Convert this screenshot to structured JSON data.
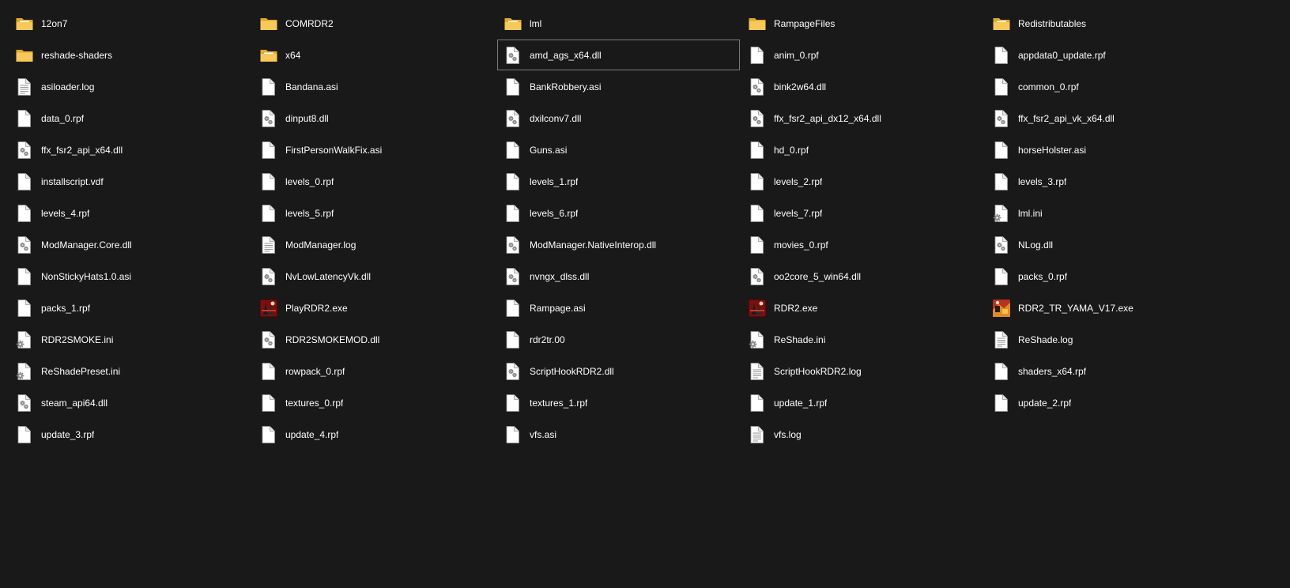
{
  "colors": {
    "background": "#191919",
    "text": "#ffffff",
    "folder": "#f0c14b",
    "selection_border": "#7a7a7a"
  },
  "items": [
    {
      "name": "12on7",
      "icon": "folder-open-icon",
      "selected": false
    },
    {
      "name": "COMRDR2",
      "icon": "folder-icon",
      "selected": false
    },
    {
      "name": "lml",
      "icon": "folder-open-icon",
      "selected": false
    },
    {
      "name": "RampageFiles",
      "icon": "folder-icon",
      "selected": false
    },
    {
      "name": "Redistributables",
      "icon": "folder-open-icon",
      "selected": false
    },
    {
      "name": "reshade-shaders",
      "icon": "folder-icon",
      "selected": false
    },
    {
      "name": "x64",
      "icon": "folder-open-icon",
      "selected": false
    },
    {
      "name": "amd_ags_x64.dll",
      "icon": "dll-file-icon",
      "selected": true
    },
    {
      "name": "anim_0.rpf",
      "icon": "file-icon",
      "selected": false
    },
    {
      "name": "appdata0_update.rpf",
      "icon": "file-icon",
      "selected": false
    },
    {
      "name": "asiloader.log",
      "icon": "text-file-icon",
      "selected": false
    },
    {
      "name": "Bandana.asi",
      "icon": "file-icon",
      "selected": false
    },
    {
      "name": "BankRobbery.asi",
      "icon": "file-icon",
      "selected": false
    },
    {
      "name": "bink2w64.dll",
      "icon": "dll-file-icon",
      "selected": false
    },
    {
      "name": "common_0.rpf",
      "icon": "file-icon",
      "selected": false
    },
    {
      "name": "data_0.rpf",
      "icon": "file-icon",
      "selected": false
    },
    {
      "name": "dinput8.dll",
      "icon": "dll-file-icon",
      "selected": false
    },
    {
      "name": "dxilconv7.dll",
      "icon": "dll-file-icon",
      "selected": false
    },
    {
      "name": "ffx_fsr2_api_dx12_x64.dll",
      "icon": "dll-file-icon",
      "selected": false
    },
    {
      "name": "ffx_fsr2_api_vk_x64.dll",
      "icon": "dll-file-icon",
      "selected": false
    },
    {
      "name": "ffx_fsr2_api_x64.dll",
      "icon": "dll-file-icon",
      "selected": false
    },
    {
      "name": "FirstPersonWalkFix.asi",
      "icon": "file-icon",
      "selected": false
    },
    {
      "name": "Guns.asi",
      "icon": "file-icon",
      "selected": false
    },
    {
      "name": "hd_0.rpf",
      "icon": "file-icon",
      "selected": false
    },
    {
      "name": "horseHolster.asi",
      "icon": "file-icon",
      "selected": false
    },
    {
      "name": "installscript.vdf",
      "icon": "file-icon",
      "selected": false
    },
    {
      "name": "levels_0.rpf",
      "icon": "file-icon",
      "selected": false
    },
    {
      "name": "levels_1.rpf",
      "icon": "file-icon",
      "selected": false
    },
    {
      "name": "levels_2.rpf",
      "icon": "file-icon",
      "selected": false
    },
    {
      "name": "levels_3.rpf",
      "icon": "file-icon",
      "selected": false
    },
    {
      "name": "levels_4.rpf",
      "icon": "file-icon",
      "selected": false
    },
    {
      "name": "levels_5.rpf",
      "icon": "file-icon",
      "selected": false
    },
    {
      "name": "levels_6.rpf",
      "icon": "file-icon",
      "selected": false
    },
    {
      "name": "levels_7.rpf",
      "icon": "file-icon",
      "selected": false
    },
    {
      "name": "lml.ini",
      "icon": "ini-file-icon",
      "selected": false
    },
    {
      "name": "ModManager.Core.dll",
      "icon": "dll-file-icon",
      "selected": false
    },
    {
      "name": "ModManager.log",
      "icon": "text-file-icon",
      "selected": false
    },
    {
      "name": "ModManager.NativeInterop.dll",
      "icon": "dll-file-icon",
      "selected": false
    },
    {
      "name": "movies_0.rpf",
      "icon": "file-icon",
      "selected": false
    },
    {
      "name": "NLog.dll",
      "icon": "dll-file-icon",
      "selected": false
    },
    {
      "name": "NonStickyHats1.0.asi",
      "icon": "file-icon",
      "selected": false
    },
    {
      "name": "NvLowLatencyVk.dll",
      "icon": "dll-file-icon",
      "selected": false
    },
    {
      "name": "nvngx_dlss.dll",
      "icon": "dll-file-icon",
      "selected": false
    },
    {
      "name": "oo2core_5_win64.dll",
      "icon": "dll-file-icon",
      "selected": false
    },
    {
      "name": "packs_0.rpf",
      "icon": "file-icon",
      "selected": false
    },
    {
      "name": "packs_1.rpf",
      "icon": "file-icon",
      "selected": false
    },
    {
      "name": "PlayRDR2.exe",
      "icon": "rdr2-exe-icon",
      "selected": false
    },
    {
      "name": "Rampage.asi",
      "icon": "file-icon",
      "selected": false
    },
    {
      "name": "RDR2.exe",
      "icon": "rdr2-exe-icon",
      "selected": false
    },
    {
      "name": "RDR2_TR_YAMA_V17.exe",
      "icon": "trainer-exe-icon",
      "selected": false
    },
    {
      "name": "RDR2SMOKE.ini",
      "icon": "ini-file-icon",
      "selected": false
    },
    {
      "name": "RDR2SMOKEMOD.dll",
      "icon": "dll-file-icon",
      "selected": false
    },
    {
      "name": "rdr2tr.00",
      "icon": "file-icon",
      "selected": false
    },
    {
      "name": "ReShade.ini",
      "icon": "ini-file-icon",
      "selected": false
    },
    {
      "name": "ReShade.log",
      "icon": "text-file-icon",
      "selected": false
    },
    {
      "name": "ReShadePreset.ini",
      "icon": "ini-file-icon",
      "selected": false
    },
    {
      "name": "rowpack_0.rpf",
      "icon": "file-icon",
      "selected": false
    },
    {
      "name": "ScriptHookRDR2.dll",
      "icon": "dll-file-icon",
      "selected": false
    },
    {
      "name": "ScriptHookRDR2.log",
      "icon": "text-file-icon",
      "selected": false
    },
    {
      "name": "shaders_x64.rpf",
      "icon": "file-icon",
      "selected": false
    },
    {
      "name": "steam_api64.dll",
      "icon": "dll-file-icon",
      "selected": false
    },
    {
      "name": "textures_0.rpf",
      "icon": "file-icon",
      "selected": false
    },
    {
      "name": "textures_1.rpf",
      "icon": "file-icon",
      "selected": false
    },
    {
      "name": "update_1.rpf",
      "icon": "file-icon",
      "selected": false
    },
    {
      "name": "update_2.rpf",
      "icon": "file-icon",
      "selected": false
    },
    {
      "name": "update_3.rpf",
      "icon": "file-icon",
      "selected": false
    },
    {
      "name": "update_4.rpf",
      "icon": "file-icon",
      "selected": false
    },
    {
      "name": "vfs.asi",
      "icon": "file-icon",
      "selected": false
    },
    {
      "name": "vfs.log",
      "icon": "text-file-icon",
      "selected": false
    }
  ]
}
